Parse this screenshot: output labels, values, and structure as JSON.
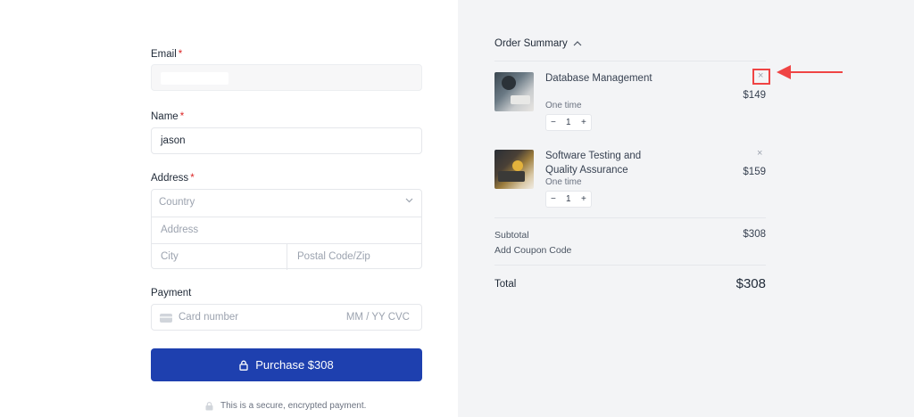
{
  "form": {
    "email_label": "Email",
    "name_label": "Name",
    "name_value": "jason",
    "address_label": "Address",
    "country_placeholder": "Country",
    "address_placeholder": "Address",
    "city_placeholder": "City",
    "zip_placeholder": "Postal Code/Zip",
    "payment_label": "Payment",
    "card_placeholder": "Card number",
    "card_exp_cvc": "MM / YY  CVC",
    "required_mark": "*",
    "purchase_label": "Purchase $308",
    "secure_note": "This is a secure, encrypted payment."
  },
  "summary": {
    "title": "Order Summary",
    "items": [
      {
        "name": "Database Management",
        "billing": "One time",
        "quantity": "1",
        "price": "$149"
      },
      {
        "name": "Software Testing and Quality Assurance",
        "billing": "One time",
        "quantity": "1",
        "price": "$159"
      }
    ],
    "stepper_minus": "−",
    "stepper_plus": "+",
    "remove_symbol": "×",
    "subtotal_label": "Subtotal",
    "subtotal_value": "$308",
    "coupon_label": "Add Coupon Code",
    "total_label": "Total",
    "total_value": "$308"
  },
  "colors": {
    "accent": "#1e40af",
    "required": "#dc2626",
    "annotation": "#ef4444",
    "panel_bg": "#f3f4f6"
  }
}
